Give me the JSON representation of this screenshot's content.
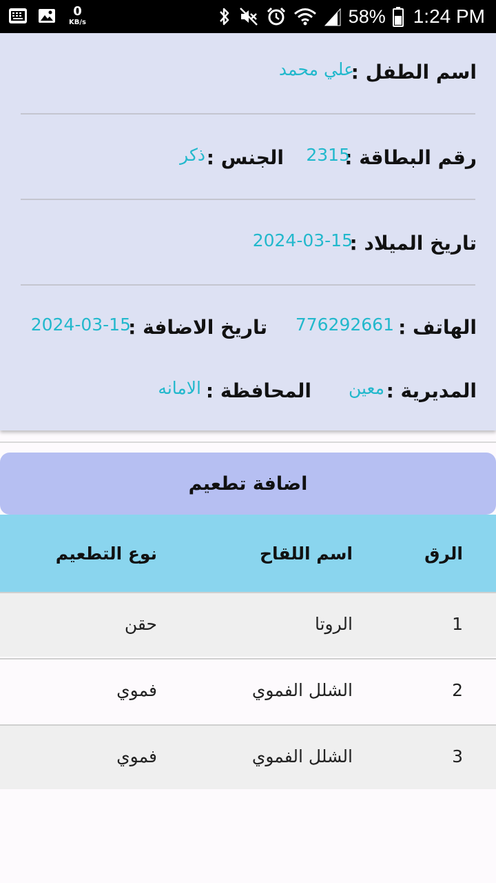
{
  "status_bar": {
    "net_speed_value": "0",
    "net_speed_unit": "KB/s",
    "battery_percent": "58%",
    "time": "1:24 PM",
    "icons": [
      "keyboard-icon",
      "image-icon",
      "bluetooth-icon",
      "mute-icon",
      "alarm-icon",
      "wifi-icon",
      "signal-icon",
      "battery-icon"
    ]
  },
  "child_info": {
    "name_label": "اسم الطفل :",
    "name_value": "علي محمد",
    "card_number_label": "رقم البطاقة :",
    "card_number_value": "2315",
    "gender_label": "الجنس :",
    "gender_value": "ذكر",
    "birth_date_label": "تاريخ الميلاد :",
    "birth_date_value": "2024-03-15",
    "phone_label": "الهاتف :",
    "phone_value": "776292661",
    "add_date_label": "تاريخ الاضافة :",
    "add_date_value": "2024-03-15",
    "directorate_label": "المديرية :",
    "directorate_value": "معين",
    "governorate_label": "المحافظة :",
    "governorate_value": "الامانه"
  },
  "add_vaccination_button": "اضافة تطعيم",
  "vaccination_table": {
    "headers": {
      "number": "الرق",
      "vaccine_name": "اسم اللقاح",
      "vaccination_type": "نوع التطعيم"
    },
    "rows": [
      {
        "number": "1",
        "vaccine_name": "الروتا",
        "vaccination_type": "حقن"
      },
      {
        "number": "2",
        "vaccine_name": "الشلل الفموي",
        "vaccination_type": "فموي"
      },
      {
        "number": "3",
        "vaccine_name": "الشلل الفموي",
        "vaccination_type": "فموي"
      }
    ]
  },
  "colors": {
    "card_background": "#dde1f3",
    "value_text": "#22b8cc",
    "button_background": "#b6bff2",
    "table_header_background": "#8ad5ee",
    "row_alt_background": "#efefef"
  }
}
